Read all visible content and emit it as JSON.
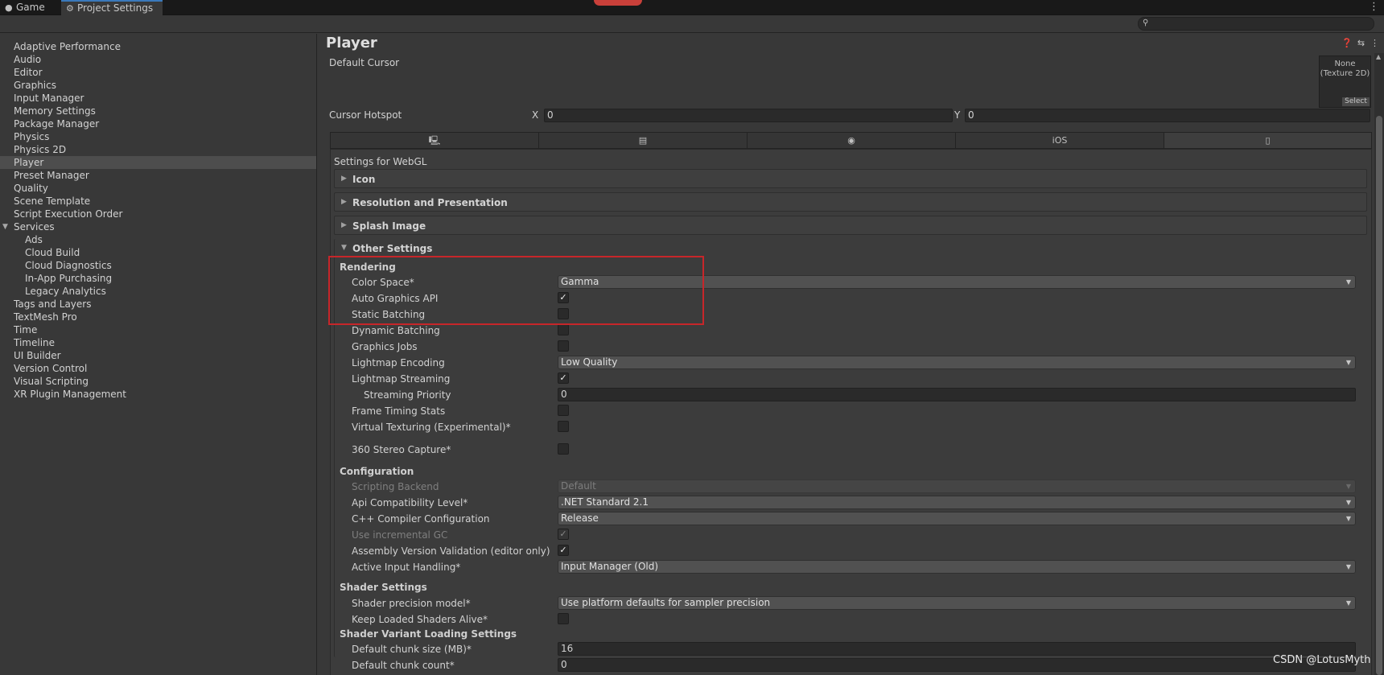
{
  "tabs": [
    {
      "label": "Game",
      "icon": "gamepad-icon"
    },
    {
      "label": "Project Settings",
      "icon": "gear-icon"
    }
  ],
  "search": {
    "value": ""
  },
  "sidebar": {
    "items": [
      {
        "label": "Adaptive Performance"
      },
      {
        "label": "Audio"
      },
      {
        "label": "Editor"
      },
      {
        "label": "Graphics"
      },
      {
        "label": "Input Manager"
      },
      {
        "label": "Memory Settings"
      },
      {
        "label": "Package Manager"
      },
      {
        "label": "Physics"
      },
      {
        "label": "Physics 2D"
      },
      {
        "label": "Player"
      },
      {
        "label": "Preset Manager"
      },
      {
        "label": "Quality"
      },
      {
        "label": "Scene Template"
      },
      {
        "label": "Script Execution Order"
      },
      {
        "label": "Services"
      },
      {
        "label": "Ads"
      },
      {
        "label": "Cloud Build"
      },
      {
        "label": "Cloud Diagnostics"
      },
      {
        "label": "In-App Purchasing"
      },
      {
        "label": "Legacy Analytics"
      },
      {
        "label": "Tags and Layers"
      },
      {
        "label": "TextMesh Pro"
      },
      {
        "label": "Time"
      },
      {
        "label": "Timeline"
      },
      {
        "label": "UI Builder"
      },
      {
        "label": "Version Control"
      },
      {
        "label": "Visual Scripting"
      },
      {
        "label": "XR Plugin Management"
      }
    ],
    "selected": "Player"
  },
  "main": {
    "title": "Player",
    "default_cursor_label": "Default Cursor",
    "cursor_texture": {
      "line1": "None",
      "line2": "(Texture 2D)",
      "select": "Select"
    },
    "cursor_hotspot": {
      "label": "Cursor Hotspot",
      "x_label": "X",
      "x_value": "0",
      "y_label": "Y",
      "y_value": "0"
    },
    "platform_tabs": [
      {
        "icon": "monitor-icon",
        "text": ""
      },
      {
        "icon": "server-icon",
        "text": ""
      },
      {
        "icon": "android-icon",
        "text": ""
      },
      {
        "icon": "ios-icon",
        "text": "iOS"
      },
      {
        "icon": "html5-icon",
        "text": ""
      }
    ],
    "settings_for": "Settings for WebGL",
    "foldouts": [
      "Icon",
      "Resolution and Presentation",
      "Splash Image",
      "Other Settings"
    ],
    "rendering": {
      "heading": "Rendering",
      "color_space": {
        "label": "Color Space*",
        "value": "Gamma"
      },
      "auto_graphics_api": {
        "label": "Auto Graphics API",
        "checked": true
      },
      "static_batching": {
        "label": "Static Batching",
        "checked": false
      },
      "dynamic_batching": {
        "label": "Dynamic Batching",
        "checked": false
      },
      "graphics_jobs": {
        "label": "Graphics Jobs",
        "checked": false
      },
      "lightmap_encoding": {
        "label": "Lightmap Encoding",
        "value": "Low Quality"
      },
      "lightmap_streaming": {
        "label": "Lightmap Streaming",
        "checked": true
      },
      "streaming_priority": {
        "label": "Streaming Priority",
        "value": "0"
      },
      "frame_timing_stats": {
        "label": "Frame Timing Stats",
        "checked": false
      },
      "virtual_texturing": {
        "label": "Virtual Texturing (Experimental)*",
        "checked": false
      },
      "stereo_capture": {
        "label": "360 Stereo Capture*",
        "checked": false
      }
    },
    "configuration": {
      "heading": "Configuration",
      "scripting_backend": {
        "label": "Scripting Backend",
        "value": "Default"
      },
      "api_compat": {
        "label": "Api Compatibility Level*",
        "value": ".NET Standard 2.1"
      },
      "cpp_compiler": {
        "label": "C++ Compiler Configuration",
        "value": "Release"
      },
      "incremental_gc": {
        "label": "Use incremental GC",
        "checked": true
      },
      "assembly_validation": {
        "label": "Assembly Version Validation (editor only)",
        "checked": true
      },
      "active_input": {
        "label": "Active Input Handling*",
        "value": "Input Manager (Old)"
      }
    },
    "shader_settings": {
      "heading": "Shader Settings",
      "precision_model": {
        "label": "Shader precision model*",
        "value": "Use platform defaults for sampler precision"
      },
      "keep_loaded": {
        "label": "Keep Loaded Shaders Alive*",
        "checked": false
      }
    },
    "shader_variant": {
      "heading": "Shader Variant Loading Settings",
      "chunk_size": {
        "label": "Default chunk size (MB)*",
        "value": "16"
      },
      "chunk_count": {
        "label": "Default chunk count*",
        "value": "0"
      }
    }
  },
  "watermark": "CSDN @LotusMyth",
  "colors": {
    "accent": "#3a79bb",
    "highlight_box": "#c7262a",
    "recording": "#c9403a"
  }
}
